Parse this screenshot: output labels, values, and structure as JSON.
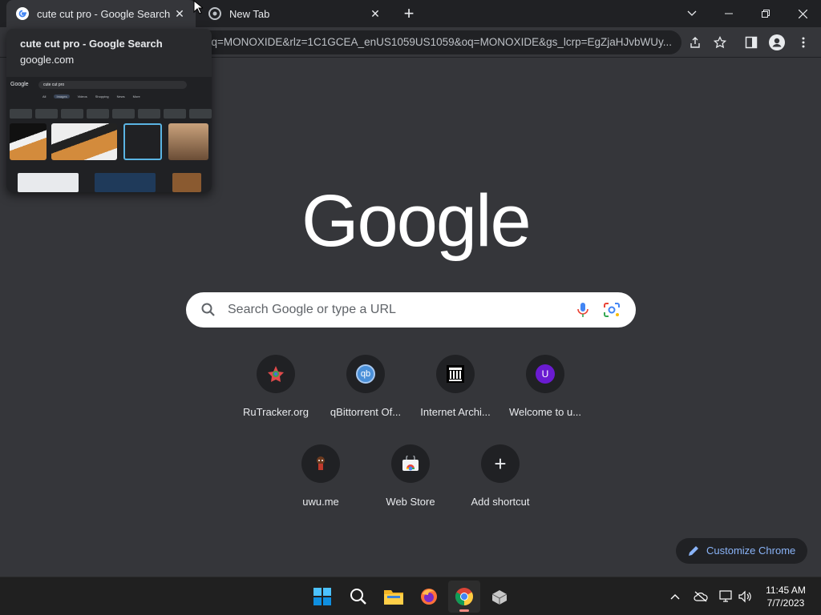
{
  "tabs": [
    {
      "title": "cute cut pro - Google Search",
      "active": true
    },
    {
      "title": "New Tab",
      "active": false
    }
  ],
  "toolbar": {
    "url_text": "?q=MONOXIDE&rlz=1C1GCEA_enUS1059US1059&oq=MONOXIDE&gs_lcrp=EgZjaHJvbWUy..."
  },
  "hover_card": {
    "title": "cute cut pro - Google Search",
    "domain": "google.com",
    "thumb_logo": "Google",
    "thumb_query": "cute cut pro",
    "thumb_tabs": [
      "All",
      "Images",
      "Videos",
      "Shopping",
      "News",
      "More"
    ]
  },
  "ntp": {
    "logo": "Google",
    "search_placeholder": "Search Google or type a URL",
    "shortcuts": [
      {
        "label": "RuTracker.org",
        "icon": "rutracker-icon"
      },
      {
        "label": "qBittorrent Of...",
        "icon": "qbittorrent-icon",
        "glyph": "qb"
      },
      {
        "label": "Internet Archi...",
        "icon": "internet-archive-icon"
      },
      {
        "label": "Welcome to u...",
        "icon": "u-letter-icon",
        "glyph": "U"
      },
      {
        "label": "uwu.me",
        "icon": "uwu-icon"
      },
      {
        "label": "Web Store",
        "icon": "web-store-icon"
      },
      {
        "label": "Add shortcut",
        "icon": "plus-icon",
        "glyph": "+"
      }
    ],
    "customize_label": "Customize Chrome"
  },
  "taskbar": {
    "time": "11:45 AM",
    "date": "7/7/2023"
  },
  "colors": {
    "background": "#35363a",
    "tabstrip": "#202124",
    "accent_blue": "#8ab4f8"
  }
}
